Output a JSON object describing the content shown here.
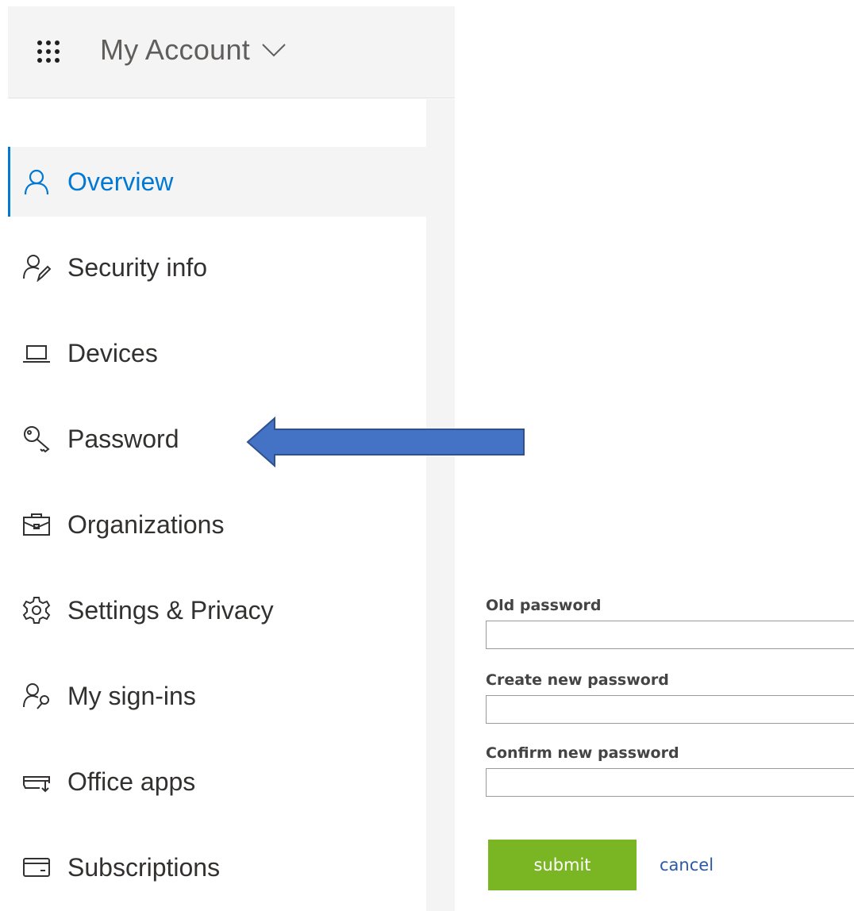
{
  "header": {
    "title": "My Account",
    "waffle_icon": "waffle-icon",
    "chevron_icon": "chevron-down-icon"
  },
  "sidebar": {
    "active_color": "#0078d4",
    "items": [
      {
        "label": "Overview",
        "icon": "person-icon",
        "active": true
      },
      {
        "label": "Security info",
        "icon": "person-pen-icon",
        "active": false
      },
      {
        "label": "Devices",
        "icon": "laptop-icon",
        "active": false
      },
      {
        "label": "Password",
        "icon": "key-icon",
        "active": false
      },
      {
        "label": "Organizations",
        "icon": "briefcase-icon",
        "active": false
      },
      {
        "label": "Settings & Privacy",
        "icon": "gear-icon",
        "active": false
      },
      {
        "label": "My sign-ins",
        "icon": "person-key-icon",
        "active": false
      },
      {
        "label": "Office apps",
        "icon": "office-download-icon",
        "active": false
      },
      {
        "label": "Subscriptions",
        "icon": "card-icon",
        "active": false
      }
    ]
  },
  "annotation": {
    "arrow_icon": "left-arrow-icon",
    "arrow_color": "#4472c4"
  },
  "form": {
    "old_password_label": "Old password",
    "old_password_value": "",
    "new_password_label": "Create new password",
    "new_password_value": "",
    "confirm_password_label": "Confirm new password",
    "confirm_password_value": "",
    "submit_label": "submit",
    "submit_color": "#7ab624",
    "cancel_label": "cancel",
    "cancel_color": "#2a59a8"
  }
}
